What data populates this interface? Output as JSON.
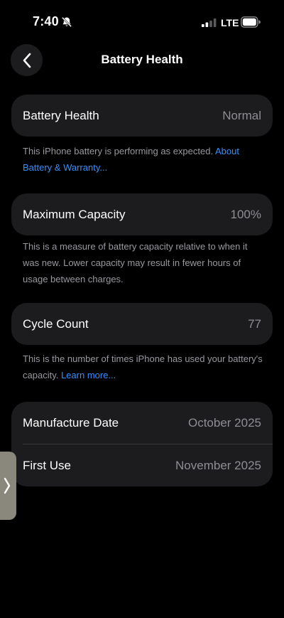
{
  "status_bar": {
    "time": "7:40",
    "carrier": "LTE",
    "icons": [
      "bell-slash-icon",
      "signal-icon",
      "battery-icon"
    ]
  },
  "nav": {
    "back_icon": "chevron-left-icon",
    "title": "Battery Health"
  },
  "battery_health": {
    "label": "Battery Health",
    "value": "Normal",
    "note": "This iPhone battery is performing as expected. ",
    "link": "About Battery & Warranty..."
  },
  "maximum_capacity": {
    "label": "Maximum Capacity",
    "value": "100%",
    "note": "This is a measure of battery capacity relative to when it was new. Lower capacity may result in fewer hours of usage between charges."
  },
  "cycle_count": {
    "label": "Cycle Count",
    "value": "77",
    "note": "This is the number of times iPhone has used your battery's capacity. ",
    "link": "Learn more..."
  },
  "dates": {
    "manufacture_label": "Manufacture Date",
    "manufacture_value": "October 2025",
    "first_use_label": "First Use",
    "first_use_value": "November 2025"
  },
  "colors": {
    "background": "#000000",
    "card": "#1c1c1e",
    "link": "#3a8ffd",
    "secondary_text": "#8e8e93"
  }
}
